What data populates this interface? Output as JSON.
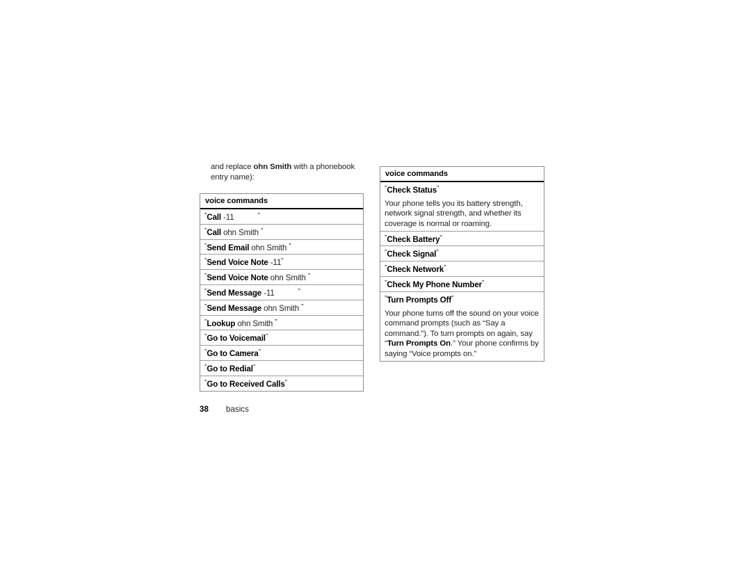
{
  "page": {
    "intro_prefix": "and replace ",
    "intro_bold": "ohn Smith",
    "intro_suffix": " with a phonebook entry name):",
    "footer_page_number": "38",
    "footer_section": "basics",
    "open_quote": "”",
    "close_quote": "”"
  },
  "table_left": {
    "header": "voice commands",
    "rows": [
      {
        "command": "Call",
        "arg": " -11",
        "trailing_gap": true
      },
      {
        "command": "Call",
        "arg": " ohn Smith ",
        "trailing_gap": false
      },
      {
        "command": "Send Email",
        "arg": " ohn Smith ",
        "trailing_gap": false
      },
      {
        "command": "Send Voice Note",
        "arg": " -11",
        "trailing_gap": false
      },
      {
        "command": "Send Voice Note",
        "arg": " ohn Smith ",
        "trailing_gap": false
      },
      {
        "command": "Send Message",
        "arg": " -11",
        "trailing_gap": true
      },
      {
        "command": "Send Message",
        "arg": " ohn Smith ",
        "trailing_gap": false
      },
      {
        "command": "Lookup",
        "arg": " ohn Smith ",
        "trailing_gap": false
      },
      {
        "command": "Go to Voicemail",
        "arg": "",
        "trailing_gap": false
      },
      {
        "command": "Go to Camera",
        "arg": "",
        "trailing_gap": false
      },
      {
        "command": "Go to Redial",
        "arg": "",
        "trailing_gap": false
      },
      {
        "command": "Go to Received Calls",
        "arg": "",
        "trailing_gap": false
      }
    ]
  },
  "table_right": {
    "header": "voice commands",
    "rows": [
      {
        "command": "Check Status",
        "arg": "",
        "description": "Your phone tells you its battery strength, network signal strength, and whether its coverage is normal or roaming."
      },
      {
        "command": "Check Battery",
        "arg": "",
        "description": ""
      },
      {
        "command": "Check Signal",
        "arg": "",
        "description": ""
      },
      {
        "command": "Check Network",
        "arg": "",
        "description": ""
      },
      {
        "command": "Check My Phone Number",
        "arg": "",
        "description": ""
      },
      {
        "command": "Turn Prompts Off",
        "arg": "",
        "desc_part1": "Your phone turns off the sound on your voice command prompts (such as “Say a command.”). To turn prompts on again, say “",
        "desc_bold": "Turn Prompts On",
        "desc_part2": ".” Your phone confirms by saying “Voice prompts on.”"
      }
    ]
  }
}
